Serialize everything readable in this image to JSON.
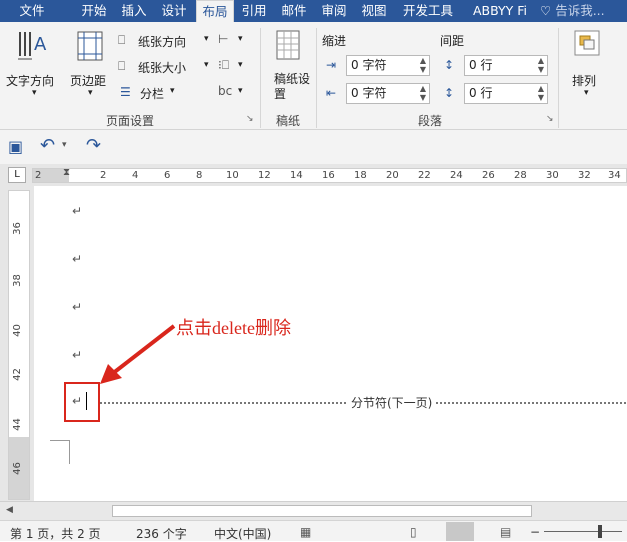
{
  "tabs": [
    {
      "label": "文件"
    },
    {
      "label": "开始"
    },
    {
      "label": "插入"
    },
    {
      "label": "设计"
    },
    {
      "label": "布局"
    },
    {
      "label": "引用"
    },
    {
      "label": "邮件"
    },
    {
      "label": "审阅"
    },
    {
      "label": "视图"
    },
    {
      "label": "开发工具"
    },
    {
      "label": "ABBYY Fi"
    }
  ],
  "tell_me": "告诉我...",
  "ribbon": {
    "text_direction": "文字方向",
    "margins": "页边距",
    "orientation": "纸张方向",
    "size": "纸张大小",
    "columns": "分栏",
    "page_setup_label": "页面设置",
    "manuscript_settings": "稿纸设置",
    "manuscript_label": "稿纸",
    "indent_label": "缩进",
    "spacing_label": "间距",
    "indent_left": "0 字符",
    "indent_right": "0 字符",
    "spacing_before": "0 行",
    "spacing_after": "0 行",
    "paragraph_label": "段落",
    "arrange": "排列"
  },
  "ruler": {
    "h": [
      "2",
      "2",
      "4",
      "6",
      "8",
      "10",
      "12",
      "14",
      "16",
      "18",
      "20",
      "22",
      "24",
      "26",
      "28",
      "30",
      "32",
      "34"
    ],
    "v": [
      "36",
      "38",
      "40",
      "42",
      "44",
      "46"
    ]
  },
  "document": {
    "para_mark": "↵",
    "section_break": "分节符(下一页)",
    "annotation": "点击delete删除"
  },
  "status": {
    "page": "第 1 页，共 2 页",
    "words": "236 个字",
    "lang": "中文(中国)"
  },
  "colors": {
    "accent": "#2b579a",
    "annotation_red": "#d9261c"
  }
}
